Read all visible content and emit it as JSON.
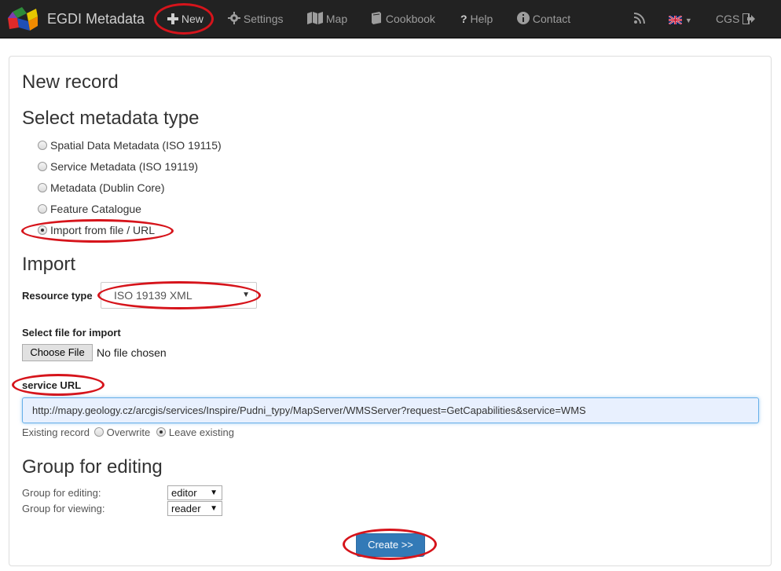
{
  "navbar": {
    "brand": "EGDI Metadata",
    "items": [
      {
        "label": "New",
        "icon": "plus-icon"
      },
      {
        "label": "Settings",
        "icon": "gear-icon"
      },
      {
        "label": "Map",
        "icon": "map-icon"
      },
      {
        "label": "Cookbook",
        "icon": "book-icon"
      },
      {
        "label": "Help",
        "icon": "question-icon"
      },
      {
        "label": "Contact",
        "icon": "info-icon"
      }
    ],
    "user": "CGS",
    "icons": {
      "rss": "rss-icon",
      "language": "uk-flag-icon",
      "logout": "logout-icon"
    }
  },
  "page": {
    "title": "New record",
    "metadata_type": {
      "heading": "Select metadata type",
      "options": [
        {
          "label": "Spatial Data Metadata (ISO 19115)",
          "checked": false
        },
        {
          "label": "Service Metadata (ISO 19119)",
          "checked": false
        },
        {
          "label": "Metadata (Dublin Core)",
          "checked": false
        },
        {
          "label": "Feature Catalogue",
          "checked": false
        },
        {
          "label": "Import from file / URL",
          "checked": true
        }
      ]
    },
    "import": {
      "heading": "Import",
      "resource_type_label": "Resource type",
      "resource_type_value": "ISO 19139 XML",
      "select_file_label": "Select file for import",
      "choose_file_button": "Choose File",
      "no_file_text": "No file chosen",
      "service_url_label": "service URL",
      "service_url_value": "http://mapy.geology.cz/arcgis/services/Inspire/Pudni_typy/MapServer/WMSServer?request=GetCapabilities&service=WMS",
      "existing_record_label": "Existing record",
      "overwrite_label": "Overwrite",
      "leave_existing_label": "Leave existing",
      "existing_choice": "Leave existing"
    },
    "group": {
      "heading": "Group for editing",
      "edit_label": "Group for editing:",
      "edit_value": "editor",
      "view_label": "Group for viewing:",
      "view_value": "reader"
    },
    "create_button": "Create >>"
  },
  "colors": {
    "navbar_bg": "#222222",
    "navbar_text": "#9d9d9d",
    "primary_button": "#337ab7",
    "highlight_annotation": "#d6141b",
    "url_input_bg": "#e8f0fe"
  }
}
